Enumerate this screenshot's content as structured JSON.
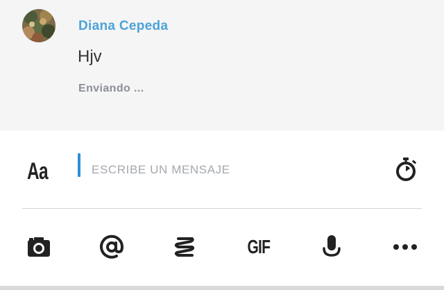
{
  "message": {
    "sender_name": "Diana Cepeda",
    "text": "Hjv",
    "status": "Enviando ..."
  },
  "composer": {
    "format_label": "Aa",
    "placeholder": "ESCRIBE UN MENSAJE",
    "timer_icon": "stopwatch-icon"
  },
  "toolbar": {
    "items": [
      {
        "icon": "camera-icon"
      },
      {
        "icon": "at-sign-icon"
      },
      {
        "icon": "spring-icon"
      },
      {
        "icon": "gif-icon",
        "label": "GIF"
      },
      {
        "icon": "microphone-icon"
      },
      {
        "icon": "more-icon"
      }
    ]
  },
  "colors": {
    "accent": "#4aa3d8",
    "caret": "#2e8fd6",
    "icon": "#222222",
    "message_background": "#f5f5f5"
  }
}
